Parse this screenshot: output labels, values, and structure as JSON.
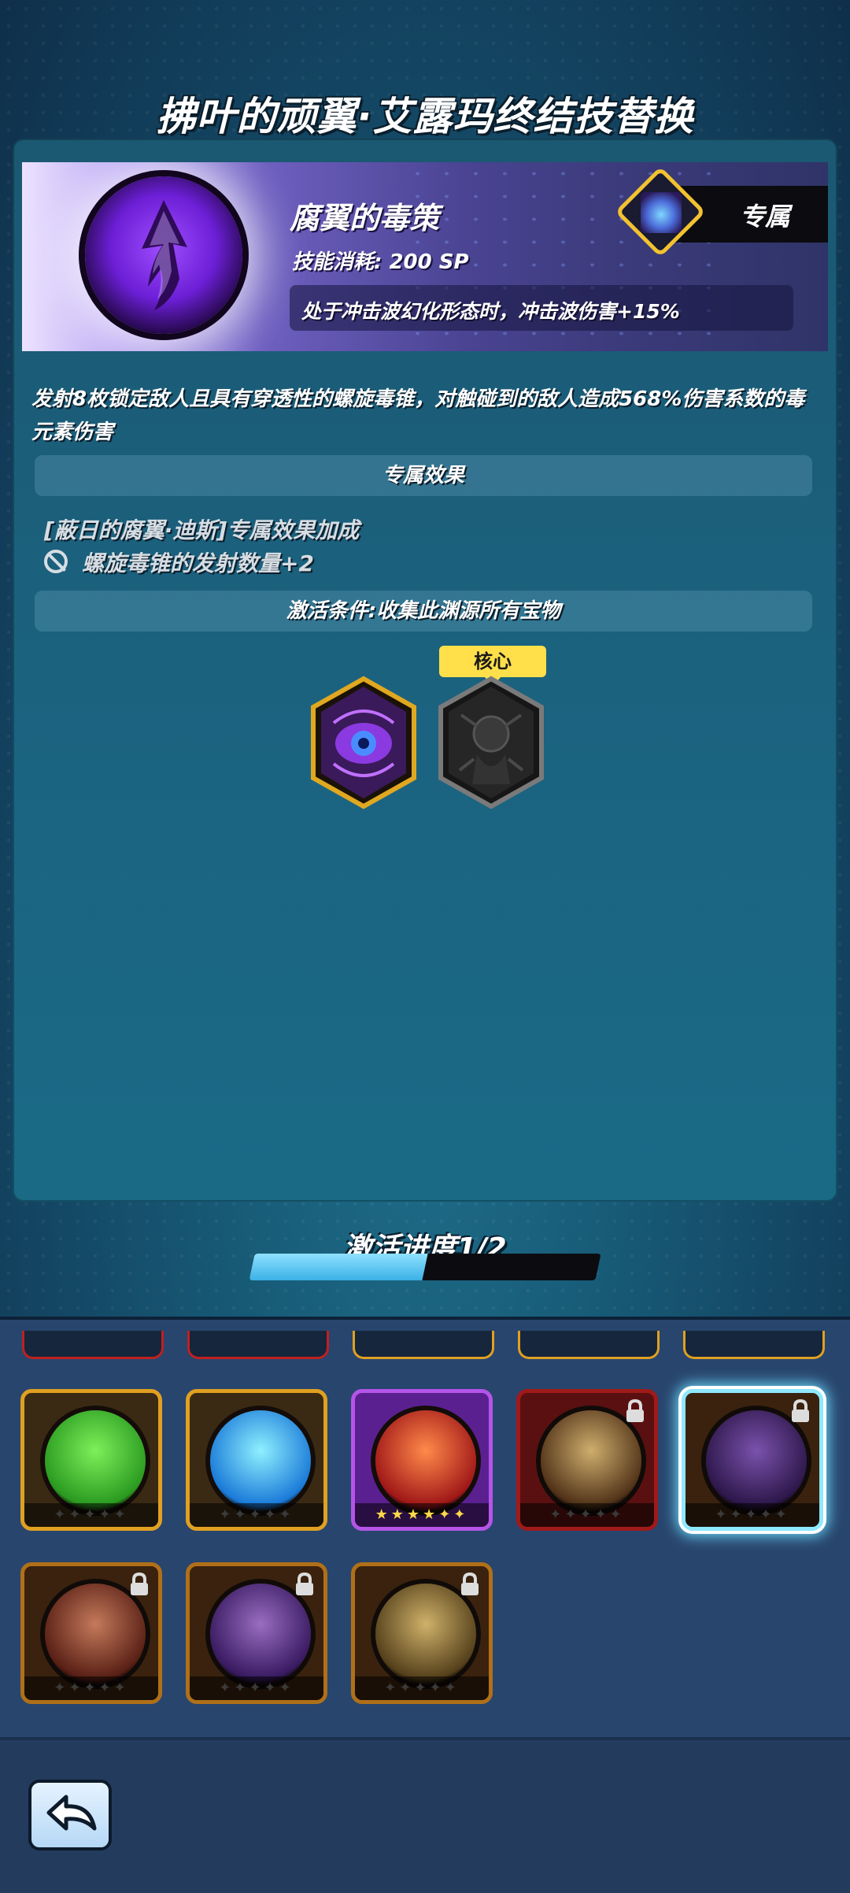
{
  "header": {
    "title": "拂叶的顽翼·艾露玛终结技替换"
  },
  "skill": {
    "name": "腐翼的毒策",
    "cost": "技能消耗: 200 SP",
    "effect": "处于冲击波幻化形态时，冲击波伤害+15%",
    "exclusive_label": "专属",
    "description": "发射8枚锁定敌人且具有穿透性的螺旋毒锥，对触碰到的敌人造成568%伤害系数的毒元素伤害"
  },
  "exclusive_section": {
    "header": "专属效果",
    "bonus_title": "[蔽日的腐翼·迪斯]专属效果加成",
    "bonus_item": "螺旋毒锥的发射数量+2"
  },
  "activation": {
    "condition_header": "激活条件:收集此渊源所有宝物",
    "core_label": "核心",
    "progress_label": "激活进度1/2",
    "progress_fraction": 0.5
  },
  "treasures": [
    {
      "name": "purple-eye-treasure",
      "frame_color": "#e0a820",
      "collected": true
    },
    {
      "name": "dark-core-treasure",
      "frame_color": "#7a7a7a",
      "collected": false
    }
  ],
  "skill_grid": {
    "row1": [
      {
        "icon": "green-arrow-skill-icon",
        "frame": "#e0a020",
        "colors": [
          "#7df05a",
          "#2a9a20"
        ],
        "stars": "✦✦✦✦✦",
        "locked": false,
        "selected": false
      },
      {
        "icon": "ice-wave-skill-icon",
        "frame": "#e0a020",
        "colors": [
          "#8ff0ff",
          "#1a7ad8"
        ],
        "stars": "✦✦✦✦✦",
        "locked": false,
        "selected": false
      },
      {
        "icon": "fire-drop-skill-icon",
        "frame": "#b455e8",
        "colors": [
          "#ff8a4a",
          "#a01818"
        ],
        "stars": "★★★★✦✦",
        "locked": false,
        "selected": false
      },
      {
        "icon": "golden-pillar-skill-icon",
        "frame": "#a01a1a",
        "colors": [
          "#ffcc66",
          "#6a3a10"
        ],
        "stars": "✦✦✦✦✦",
        "locked": true,
        "selected": false
      },
      {
        "icon": "poison-spiral-skill-icon",
        "frame": "#8ee8ff",
        "colors": [
          "#9a5ae8",
          "#3a1868"
        ],
        "stars": "✦✦✦✦✦",
        "locked": true,
        "selected": true
      }
    ],
    "row2": [
      {
        "icon": "meteor-skill-icon",
        "frame": "#b07018",
        "colors": [
          "#ff8a5a",
          "#7a2010"
        ],
        "stars": "✦✦✦✦✦",
        "locked": true
      },
      {
        "icon": "purple-vortex-skill-icon",
        "frame": "#b07018",
        "colors": [
          "#c07aff",
          "#4a1a88"
        ],
        "stars": "✦✦✦✦✦",
        "locked": true
      },
      {
        "icon": "lightning-skill-icon",
        "frame": "#b07018",
        "colors": [
          "#ffd060",
          "#6a4a10"
        ],
        "stars": "✦✦✦✦✦",
        "locked": true
      }
    ]
  },
  "footer": {
    "back_icon": "back-arrow-icon"
  }
}
